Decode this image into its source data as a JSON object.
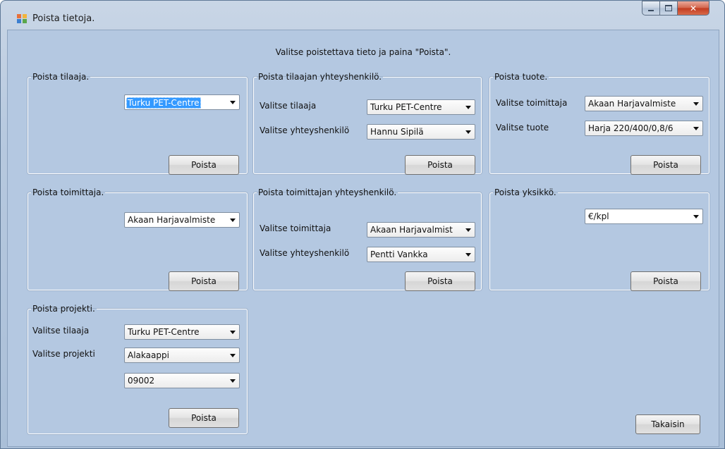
{
  "window": {
    "title": "Poista tietoja.",
    "instruction": "Valitse poistettava tieto ja paina \"Poista\"."
  },
  "groups": {
    "tilaaja": {
      "legend": "Poista tilaaja.",
      "combo": "Turku PET-Centre",
      "button": "Poista"
    },
    "tilaajan_yhteyshenkilo": {
      "legend": "Poista tilaajan yhteyshenkilö.",
      "label_tilaaja": "Valitse tilaaja",
      "combo_tilaaja": "Turku PET-Centre",
      "label_henkilo": "Valitse yhteyshenkilö",
      "combo_henkilo": "Hannu Sipilä",
      "button": "Poista"
    },
    "tuote": {
      "legend": "Poista tuote.",
      "label_toimittaja": "Valitse toimittaja",
      "combo_toimittaja": "Akaan Harjavalmiste",
      "label_tuote": "Valitse tuote",
      "combo_tuote": "Harja 220/400/0,8/6",
      "button": "Poista"
    },
    "toimittaja": {
      "legend": "Poista toimittaja.",
      "combo": "Akaan Harjavalmiste",
      "button": "Poista"
    },
    "toimittajan_yhteyshenkilo": {
      "legend": "Poista toimittajan yhteyshenkilö.",
      "label_toimittaja": "Valitse toimittaja",
      "combo_toimittaja": "Akaan Harjavalmist",
      "label_henkilo": "Valitse yhteyshenkilö",
      "combo_henkilo": "Pentti Vankka",
      "button": "Poista"
    },
    "yksikko": {
      "legend": "Poista yksikkö.",
      "combo": "€/kpl",
      "button": "Poista"
    },
    "projekti": {
      "legend": "Poista projekti.",
      "label_tilaaja": "Valitse tilaaja",
      "combo_tilaaja": "Turku PET-Centre",
      "label_projekti": "Valitse projekti",
      "combo_projekti": "Alakaappi",
      "combo_numero": "09002",
      "button": "Poista"
    }
  },
  "footer": {
    "back_button": "Takaisin"
  },
  "colors": {
    "client_bg": "#b4c8e1",
    "selection": "#3399ff",
    "close_button": "#c13b1f"
  }
}
